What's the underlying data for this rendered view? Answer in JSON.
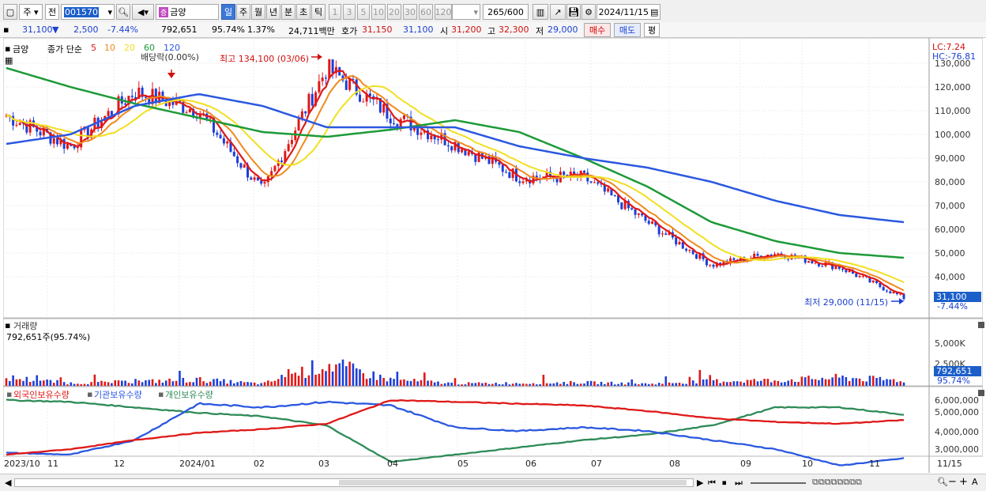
{
  "toolbar": {
    "market": "주",
    "prev": "전",
    "code": "001570",
    "name": "금양",
    "periods": [
      "일",
      "주",
      "월",
      "년",
      "분",
      "초",
      "틱"
    ],
    "active_period": "일",
    "intervals": [
      "1",
      "3",
      "5",
      "10",
      "20",
      "30",
      "60",
      "120"
    ],
    "count": "265",
    "count_total": "/600",
    "date": "2024/11/15"
  },
  "quote": {
    "price": "31,100",
    "arrow": "▼",
    "change": "2,500",
    "rate": "-7.44%",
    "volume": "792,651",
    "vol_ratio": "95.74%",
    "turnover": "1.37%",
    "amount": "24,711백만",
    "bid_label": "호가",
    "bid1": "31,150",
    "bid2": "31,100",
    "open_label": "시",
    "open": "31,200",
    "high_label": "고",
    "high": "32,300",
    "low_label": "저",
    "low": "29,000",
    "buy": "매수",
    "sell": "매도",
    "eval": "평"
  },
  "price_panel": {
    "name_tag": "금양",
    "legend_prefix": "종가 단순",
    "ma_periods": [
      "5",
      "10",
      "20",
      "60",
      "120"
    ],
    "ma_colors": [
      "#e01818",
      "#f08a1c",
      "#f0e020",
      "#1d9a38",
      "#2b58e0"
    ],
    "dividend": "배당락(0.00%)",
    "high_note": "최고 134,100 (03/06)",
    "low_note": "최저 29,000 (11/15)",
    "lc": "LC:7.24",
    "hc": "HC:-76.81",
    "y_ticks": [
      "130,000",
      "120,000",
      "110,000",
      "100,000",
      "90,000",
      "80,000",
      "70,000",
      "60,000",
      "50,000",
      "40,000"
    ],
    "cur_price": "31,100",
    "cur_rate": "-7.44%"
  },
  "volume_panel": {
    "title": "거래량",
    "value": "792,651주(95.74%)",
    "y_ticks": [
      "5,000K",
      "2,500K"
    ],
    "cur": "792,651",
    "cur_rate": "95.74%"
  },
  "holdings_panel": {
    "legend": [
      "외국인보유수량",
      "기관보유수량",
      "개인보유수량"
    ],
    "colors": [
      "#e01818",
      "#2b58e0",
      "#2e8b57"
    ],
    "y_ticks": [
      "6,000,000",
      "5,000,000",
      "4,000,000",
      "3,000,000"
    ]
  },
  "x_ticks": [
    "2023/10",
    "11",
    "12",
    "2024/01",
    "02",
    "03",
    "04",
    "05",
    "06",
    "07",
    "08",
    "09",
    "10",
    "11",
    "11/15"
  ],
  "chart_data": {
    "type": "candlestick",
    "x": [
      "2023/10",
      "11",
      "12",
      "2024/01",
      "02",
      "03",
      "04",
      "05",
      "06",
      "07",
      "08",
      "09",
      "10",
      "11",
      "11/15"
    ],
    "close": [
      108000,
      95000,
      118000,
      110000,
      76000,
      128000,
      108000,
      96000,
      82000,
      82000,
      63000,
      45000,
      50000,
      44000,
      31100
    ],
    "ma120": [
      96000,
      100000,
      112000,
      117000,
      112000,
      103000,
      103000,
      103000,
      95000,
      90000,
      86000,
      80000,
      72000,
      66000,
      63000
    ],
    "ma60": [
      128000,
      120000,
      113000,
      107000,
      101000,
      99000,
      102000,
      106000,
      101000,
      90000,
      78000,
      63000,
      55000,
      50000,
      48000
    ],
    "volume_k": [
      1200,
      400,
      600,
      900,
      300,
      3200,
      900,
      350,
      400,
      500,
      300,
      700,
      800,
      1200,
      793
    ],
    "ylim": [
      28000,
      134100
    ],
    "high_annot": 134100,
    "low_annot": 29000
  }
}
